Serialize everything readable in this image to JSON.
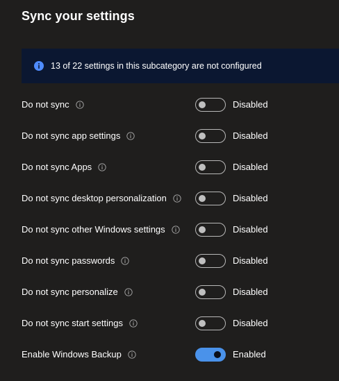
{
  "page": {
    "title": "Sync your settings"
  },
  "banner": {
    "text": "13 of 22 settings in this subcategory are not configured",
    "icon": "info-icon",
    "color": "#0b1731"
  },
  "colors": {
    "background": "#1f1e1d",
    "toggle_on": "#4a92ea",
    "info_icon": "#4f8cff"
  },
  "settings": [
    {
      "label": "Do not sync",
      "enabled": false,
      "state_text": "Disabled"
    },
    {
      "label": "Do not sync app settings",
      "enabled": false,
      "state_text": "Disabled"
    },
    {
      "label": "Do not sync Apps",
      "enabled": false,
      "state_text": "Disabled"
    },
    {
      "label": "Do not sync desktop personalization",
      "enabled": false,
      "state_text": "Disabled"
    },
    {
      "label": "Do not sync other Windows settings",
      "enabled": false,
      "state_text": "Disabled"
    },
    {
      "label": "Do not sync passwords",
      "enabled": false,
      "state_text": "Disabled"
    },
    {
      "label": "Do not sync personalize",
      "enabled": false,
      "state_text": "Disabled"
    },
    {
      "label": "Do not sync start settings",
      "enabled": false,
      "state_text": "Disabled"
    },
    {
      "label": "Enable Windows Backup",
      "enabled": true,
      "state_text": "Enabled"
    }
  ]
}
